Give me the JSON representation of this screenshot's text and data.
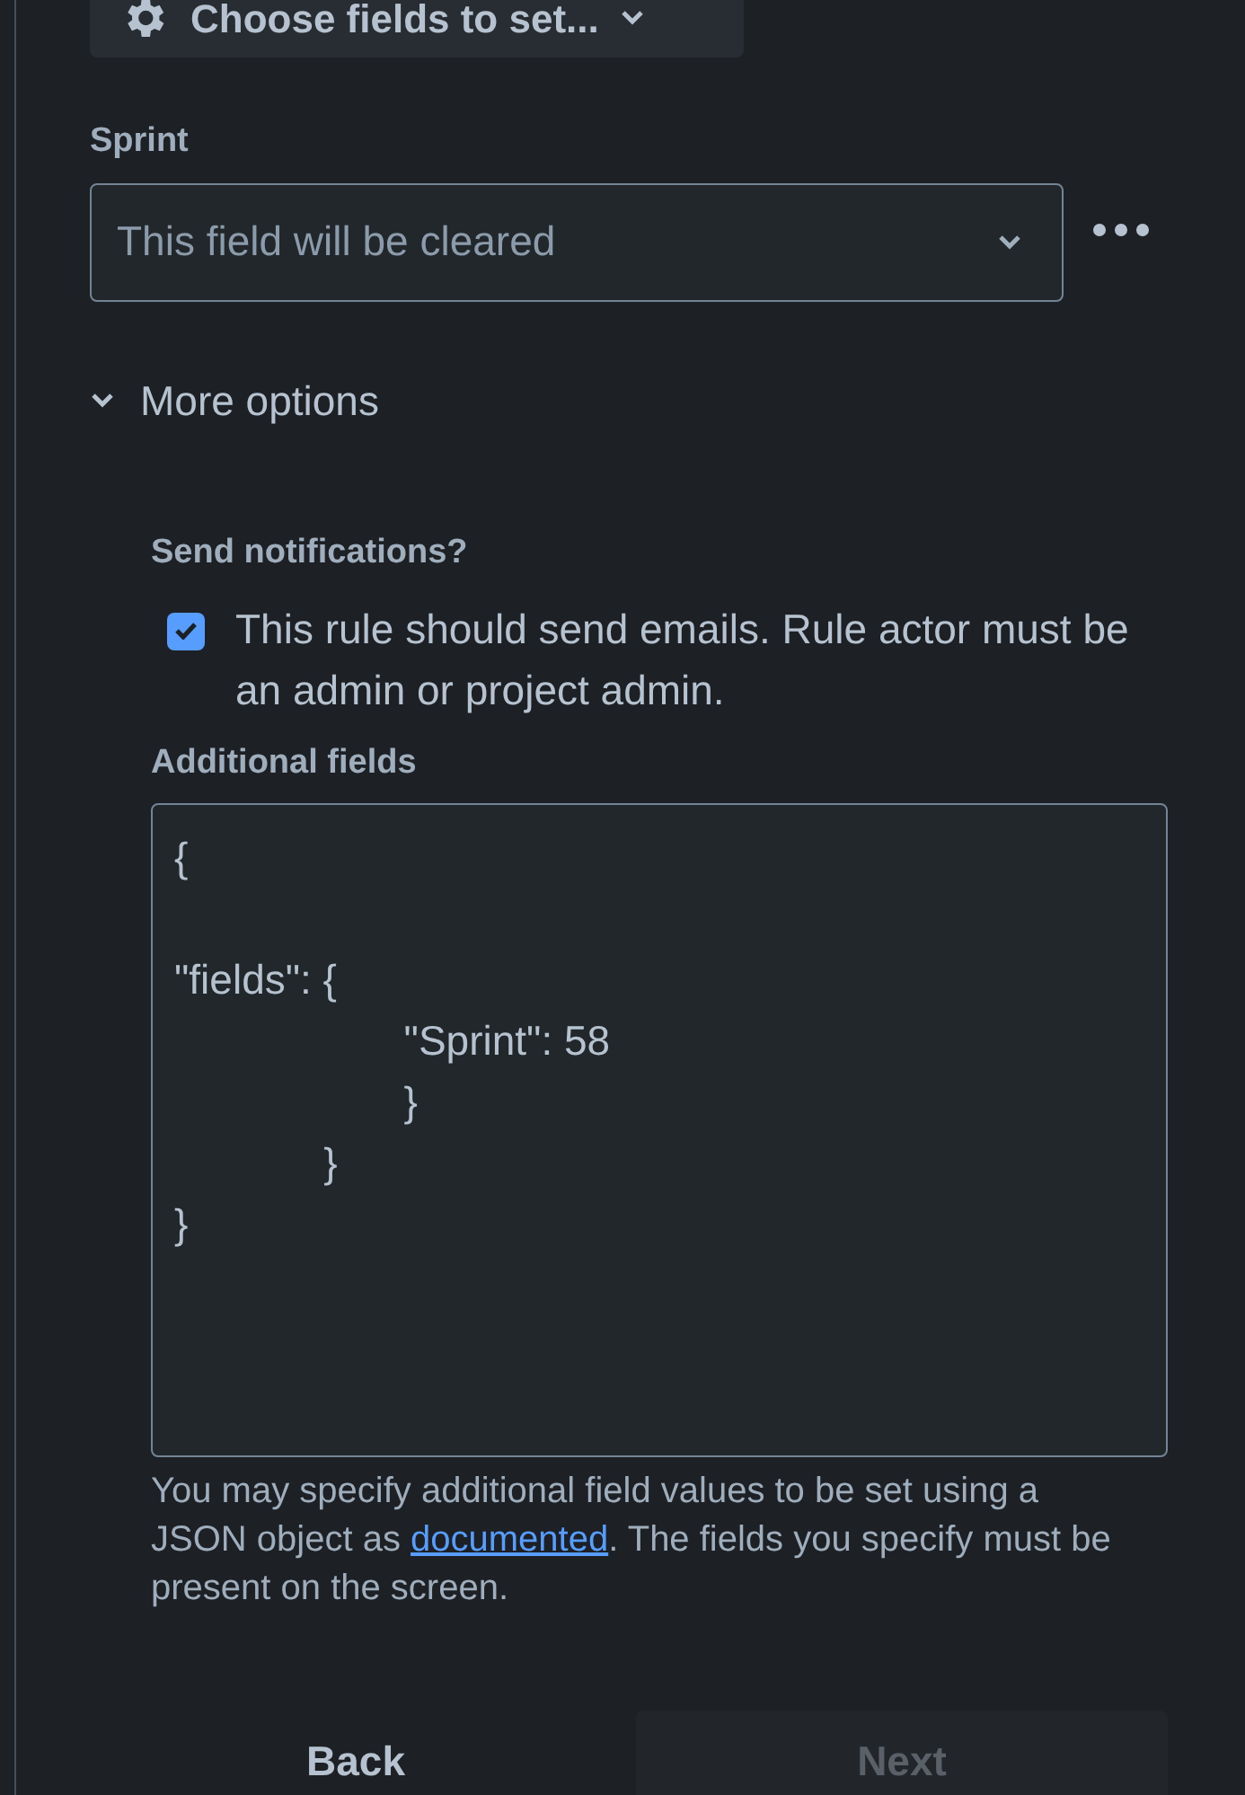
{
  "choose_fields_button": {
    "label": "Choose fields to set..."
  },
  "sprint_field": {
    "label": "Sprint",
    "placeholder": "This field will be cleared"
  },
  "more_options": {
    "label": "More options",
    "expanded": true
  },
  "notifications": {
    "label": "Send notifications?",
    "checked": true,
    "text": "This rule should send emails. Rule actor must be an admin or project admin."
  },
  "additional_fields": {
    "label": "Additional fields",
    "value": "{\n\n\"fields\": {\n                    \"Sprint\": 58\n                    }\n             }\n}",
    "help_before": "You may specify additional field values to be set using a JSON object as ",
    "help_link": "documented",
    "help_after": ". The fields you specify must be present on the screen."
  },
  "buttons": [
    {
      "label": "Back",
      "disabled": false
    },
    {
      "label": "Next",
      "disabled": true
    }
  ]
}
